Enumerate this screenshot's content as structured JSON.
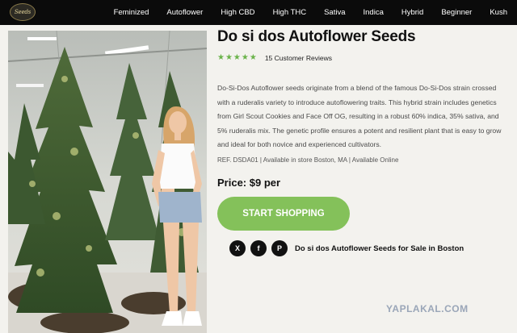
{
  "nav": {
    "logo_text": "Seeds",
    "items": [
      "Feminized",
      "Autoflower",
      "High CBD",
      "High THC",
      "Sativa",
      "Indica",
      "Hybrid",
      "Beginner",
      "Kush"
    ]
  },
  "product": {
    "title": "Do si dos Autoflower Seeds",
    "stars": "★★★★★",
    "rating": 5,
    "reviews": "15 Customer Reviews",
    "description": "Do-Si-Dos Autoflower seeds originate from a blend of the famous Do-Si-Dos strain crossed with a ruderalis variety to introduce autoflowering traits. This hybrid strain includes genetics from Girl Scout Cookies and Face Off OG, resulting in a robust 60% indica, 35% sativa, and 5% ruderalis mix. The genetic profile ensures a potent and resilient plant that is easy to grow and ideal for both novice and experienced cultivators.",
    "ref": "REF. DSDA01 | Available in store Boston, MA | Available Online",
    "price": "Price: $9 per",
    "cta": "START SHOPPING",
    "sale_text": "Do si dos Autoflower Seeds for Sale in Boston"
  },
  "share": {
    "x_label": "X",
    "fb_label": "f",
    "pin_label": "P"
  },
  "watermark": "YAPLAKAL.COM",
  "colors": {
    "nav_bg": "#0b0b0b",
    "accent_green": "#84c15a",
    "star_green": "#6ab34a",
    "page_bg": "#f3f2ee"
  }
}
